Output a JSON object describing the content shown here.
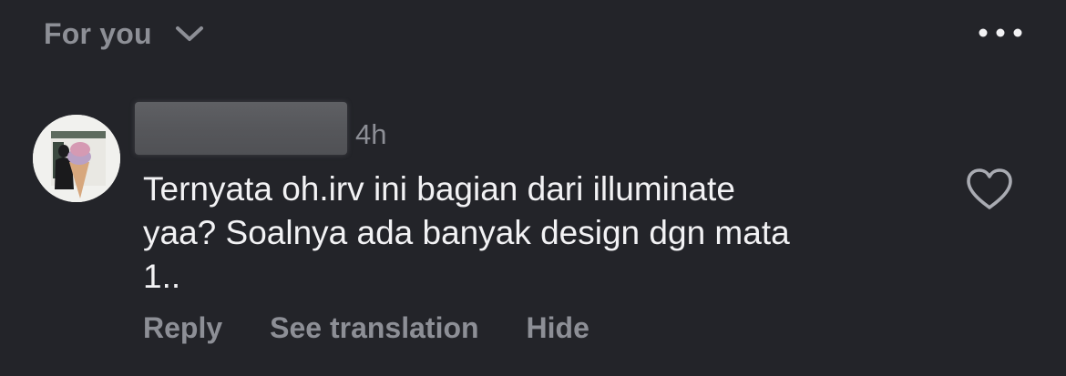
{
  "header": {
    "feed_label": "For you",
    "chevron_icon": "chevron-down-icon",
    "more_icon": "more-horizontal-icon"
  },
  "comment": {
    "username": "",
    "username_redacted": true,
    "timestamp": "4h",
    "text_lines": [
      "Ternyata oh.irv ini bagian dari illuminate",
      "yaa? Soalnya ada banyak design dgn mata",
      "1.."
    ],
    "like_icon": "heart-outline-icon",
    "actions": {
      "reply": "Reply",
      "see_translation": "See translation",
      "hide": "Hide"
    }
  },
  "colors": {
    "background": "#232429",
    "primary_text": "#f2f2f4",
    "secondary_text": "#8d8f96"
  }
}
